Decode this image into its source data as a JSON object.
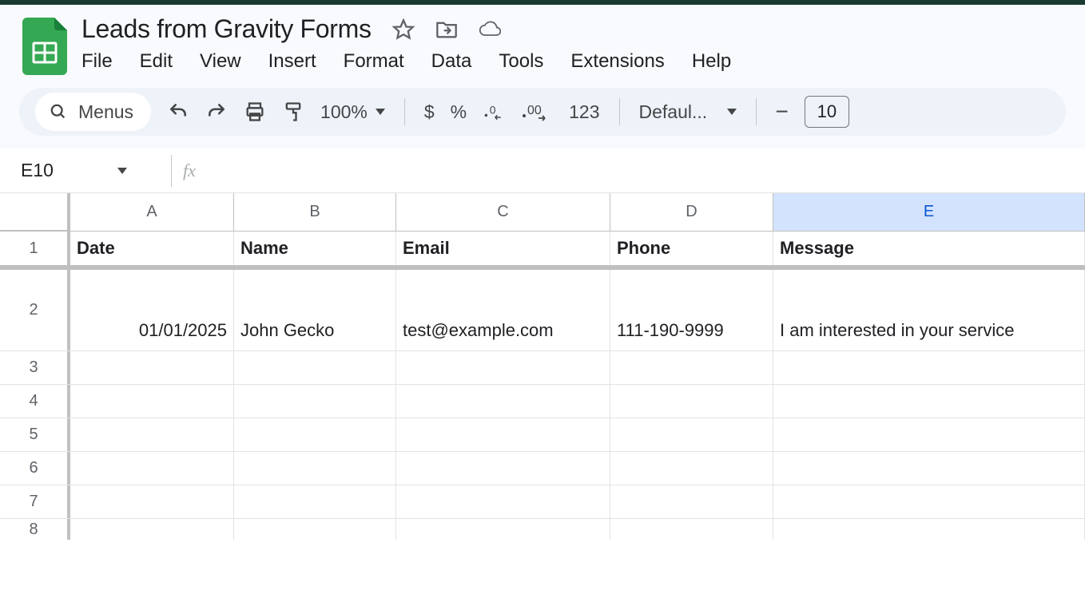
{
  "doc": {
    "title": "Leads from Gravity Forms"
  },
  "menu": {
    "file": "File",
    "edit": "Edit",
    "view": "View",
    "insert": "Insert",
    "format": "Format",
    "data": "Data",
    "tools": "Tools",
    "extensions": "Extensions",
    "help": "Help"
  },
  "toolbar": {
    "menus_label": "Menus",
    "zoom": "100%",
    "currency": "$",
    "percent": "%",
    "num_123": "123",
    "font_name": "Defaul...",
    "font_size": "10",
    "minus": "−"
  },
  "name_box": {
    "cell_ref": "E10",
    "fx": "fx"
  },
  "columns": {
    "A": "A",
    "B": "B",
    "C": "C",
    "D": "D",
    "E": "E"
  },
  "rows": {
    "r1": "1",
    "r2": "2",
    "r3": "3",
    "r4": "4",
    "r5": "5",
    "r6": "6",
    "r7": "7",
    "r8": "8"
  },
  "header_row": {
    "date": "Date",
    "name": "Name",
    "email": "Email",
    "phone": "Phone",
    "message": "Message"
  },
  "data_rows": [
    {
      "date": "01/01/2025",
      "name": "John Gecko",
      "email": "test@example.com",
      "phone": "111-190-9999",
      "message": "I am interested in your service"
    }
  ]
}
